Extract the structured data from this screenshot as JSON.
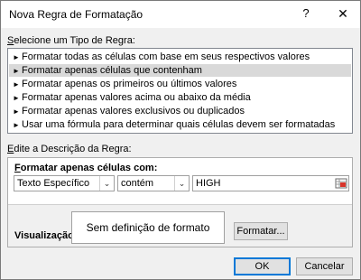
{
  "window": {
    "title": "Nova Regra de Formatação",
    "help_label": "?",
    "close_label": "✕"
  },
  "rule_type": {
    "label": "Selecione um Tipo de Regra:",
    "items": [
      {
        "label": "Formatar todas as células com base em seus respectivos valores",
        "selected": false
      },
      {
        "label": "Formatar apenas células que contenham",
        "selected": true
      },
      {
        "label": "Formatar apenas os primeiros ou últimos valores",
        "selected": false
      },
      {
        "label": "Formatar apenas valores acima ou abaixo da média",
        "selected": false
      },
      {
        "label": "Formatar apenas valores exclusivos ou duplicados",
        "selected": false
      },
      {
        "label": "Usar uma fórmula para determinar quais células devem ser formatadas",
        "selected": false
      }
    ],
    "bullet": "►"
  },
  "description": {
    "label": "Edite a Descrição da Regra:",
    "heading": "Formatar apenas células com:",
    "condition_type": "Texto Específico",
    "operator": "contém",
    "value": "HIGH",
    "dropdown_glyph": "⌄"
  },
  "preview": {
    "label": "Visualização:",
    "text": "Sem definição de formato",
    "format_button": "Formatar..."
  },
  "buttons": {
    "ok": "OK",
    "cancel": "Cancelar"
  },
  "colors": {
    "selected_row": "#d9d9d9",
    "default_button_border": "#0078d7"
  }
}
